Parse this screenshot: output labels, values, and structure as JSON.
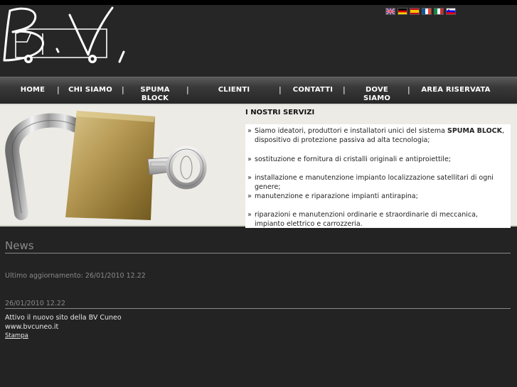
{
  "header": {
    "languages": [
      "English",
      "Deutsch",
      "Español",
      "Français",
      "Italiano",
      "Slovenščina"
    ]
  },
  "nav": {
    "items": [
      {
        "label": "HOME"
      },
      {
        "label": "CHI SIAMO"
      },
      {
        "label": "SPUMA BLOCK"
      },
      {
        "label": "CLIENTI"
      },
      {
        "label": "CONTATTI"
      },
      {
        "label": "DOVE SIAMO"
      },
      {
        "label": "AREA RISERVATA"
      }
    ],
    "separator": "|"
  },
  "banner": {
    "services_title": "I NOSTRI SERVIZI",
    "bullet": "»",
    "services": [
      {
        "text_before": "Siamo ideatori, produttori e installatori unici del sistema ",
        "bold": "SPUMA BLOCK",
        "text_after": ", dispositivo di protezione passiva ad alta tecnologia;"
      },
      {
        "text": "sostituzione e fornitura di cristalli originali e antiproiettile;"
      },
      {
        "text": "installazione e manutenzione impianto localizzazione satellitari di ogni genere;"
      },
      {
        "text": "manutenzione e riparazione impianti antirapina;"
      },
      {
        "text": "riparazioni e manutenzioni ordinarie e straordinarie di meccanica, impianto elettrico e carrozzeria."
      }
    ]
  },
  "news": {
    "title": "News",
    "last_updated": "Ultimo aggiornamento: 26/01/2010 12.22",
    "entry_date": "26/01/2010 12.22",
    "entry_lines": [
      "Attivo il nuovo sito della BV Cuneo",
      "www.bvcuneo.it"
    ],
    "print_link": "Stampa"
  },
  "colors": {
    "background": "#232323",
    "banner": "#ecebe6",
    "nav_text": "#ffffff",
    "muted_text": "#8a8a8a"
  }
}
